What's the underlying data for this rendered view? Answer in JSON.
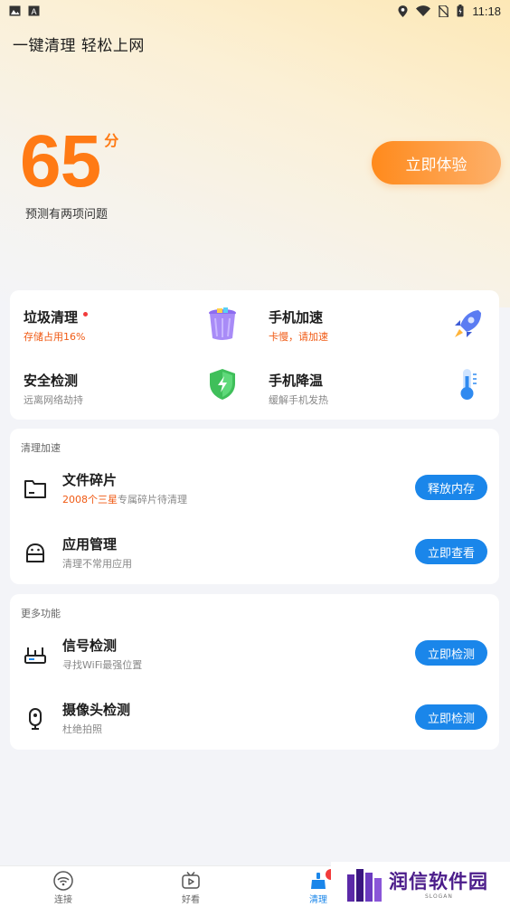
{
  "status_bar": {
    "time": "11:18",
    "left_icons": [
      "image-icon",
      "a-icon"
    ],
    "right_icons": [
      "location-icon",
      "wifi-icon",
      "no-sim-icon",
      "battery-icon"
    ]
  },
  "header": {
    "title": "一键清理 轻松上网"
  },
  "score": {
    "value": "65",
    "unit": "分",
    "subtitle": "预测有两项问题",
    "button_label": "立即体验"
  },
  "quick_tools": [
    {
      "title": "垃圾清理",
      "subtitle": "存储占用16%",
      "icon": "trash-bin-icon",
      "has_dot": true,
      "warn": true
    },
    {
      "title": "手机加速",
      "subtitle": "卡慢，请加速",
      "icon": "rocket-icon",
      "has_dot": false,
      "warn": true
    },
    {
      "title": "安全检测",
      "subtitle": "远离网络劫持",
      "icon": "shield-icon",
      "has_dot": false,
      "warn": false
    },
    {
      "title": "手机降温",
      "subtitle": "缓解手机发热",
      "icon": "thermometer-icon",
      "has_dot": false,
      "warn": false
    }
  ],
  "clean_section": {
    "title": "清理加速",
    "items": [
      {
        "title": "文件碎片",
        "subtitle_highlight": "2008个三星",
        "subtitle_rest": "专属碎片待清理",
        "button": "释放内存",
        "icon": "folder-icon"
      },
      {
        "title": "应用管理",
        "subtitle_highlight": "",
        "subtitle_rest": "清理不常用应用",
        "button": "立即查看",
        "icon": "android-icon"
      }
    ]
  },
  "more_section": {
    "title": "更多功能",
    "items": [
      {
        "title": "信号检测",
        "subtitle_highlight": "",
        "subtitle_rest": "寻找WiFi最强位置",
        "button": "立即检测",
        "icon": "router-icon"
      },
      {
        "title": "摄像头检测",
        "subtitle_highlight": "",
        "subtitle_rest": "杜绝拍照",
        "button": "立即检测",
        "icon": "camera-icon"
      }
    ]
  },
  "bottom_nav": [
    {
      "label": "连接",
      "icon": "wifi-icon",
      "active": false
    },
    {
      "label": "好看",
      "icon": "tv-play-icon",
      "active": false
    },
    {
      "label": "清理",
      "icon": "clean-broom-icon",
      "active": true
    }
  ],
  "watermark": {
    "text": "润信软件园",
    "slogan": "SLOGAN"
  },
  "colors": {
    "accent_orange": "#ff7a14",
    "button_blue": "#1a86ea",
    "warn_text": "#f05a14"
  }
}
